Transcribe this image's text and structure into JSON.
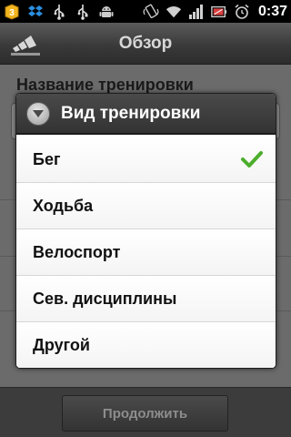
{
  "status_bar": {
    "time": "0:37",
    "left_icons": [
      "notification-badge-icon",
      "dropbox-icon",
      "usb-icon",
      "usb-icon",
      "android-debug-icon"
    ],
    "notification_badge": "3",
    "right_icons": [
      "vibrate-icon",
      "wifi-icon",
      "signal-icon",
      "battery-icon",
      "alarm-icon"
    ]
  },
  "header": {
    "logo": "adidas-logo",
    "title": "Обзор"
  },
  "background": {
    "field_label": "Название тренировки"
  },
  "dialog": {
    "title": "Вид тренировки",
    "icon": "chevron-down-circle-icon",
    "options": [
      {
        "label": "Бег",
        "selected": true
      },
      {
        "label": "Ходьба",
        "selected": false
      },
      {
        "label": "Велоспорт",
        "selected": false
      },
      {
        "label": "Сев. дисциплины",
        "selected": false
      },
      {
        "label": "Другой",
        "selected": false
      }
    ],
    "check_color": "#4cae2c"
  },
  "footer": {
    "continue_label": "Продолжить"
  }
}
